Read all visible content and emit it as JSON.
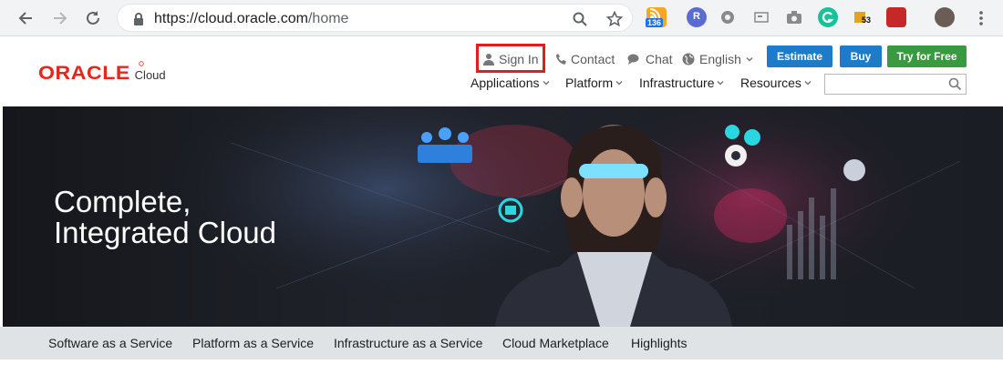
{
  "browser": {
    "url_host": "https://cloud.oracle.com",
    "url_path": "/home",
    "extension_badges": [
      "136",
      "R",
      "53"
    ]
  },
  "header": {
    "logo_word": "ORACLE",
    "logo_sub": "Cloud",
    "utility": {
      "sign_in": "Sign In",
      "contact": "Contact",
      "chat": "Chat",
      "language": "English"
    },
    "buttons": {
      "estimate": "Estimate",
      "buy": "Buy",
      "try": "Try for Free"
    },
    "nav": [
      "Applications",
      "Platform",
      "Infrastructure",
      "Resources"
    ],
    "search_value": ""
  },
  "hero": {
    "title_line1": "Complete,",
    "title_line2": "Integrated Cloud"
  },
  "subnav": [
    "Software as a Service",
    "Platform as a Service",
    "Infrastructure as a Service",
    "Cloud Marketplace",
    "Highlights"
  ],
  "colors": {
    "oracle_red": "#e5261b",
    "estimate_blue": "#1e7bc8",
    "buy_blue": "#1e7bc8",
    "try_green": "#3a9a3f",
    "highlight_red": "#e21d1d"
  }
}
